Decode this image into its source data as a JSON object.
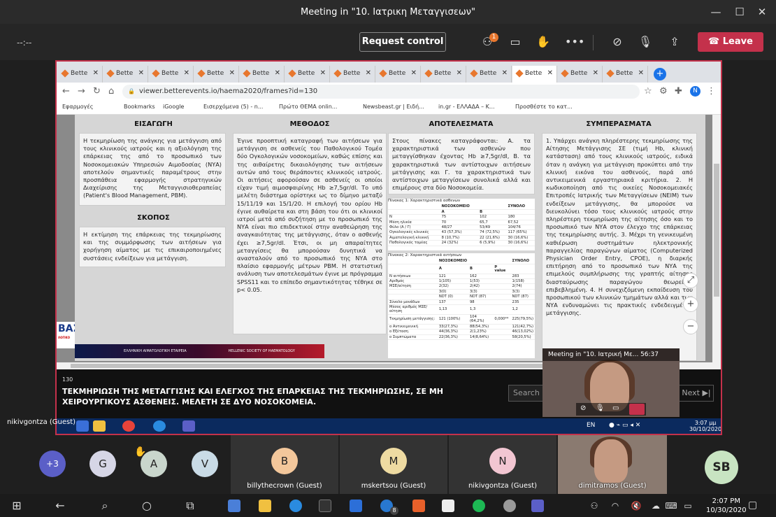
{
  "window": {
    "title": "Meeting in \"10. Ιατρικη Μεταγγισεων\""
  },
  "controls": {
    "timer": "--:--",
    "request_control": "Request control",
    "participants_badge": "1",
    "leave": "Leave"
  },
  "browser": {
    "tab_label": "Bette",
    "tab_count": 13,
    "url": "viewer.betterevents.io/haema2020/frames?id=130",
    "profile": "N",
    "bookmarks": [
      "Εφαρμογές",
      "Bookmarks",
      "iGoogle",
      "Εισερχόμενα (5) - n...",
      "Πρώτο ΘΕΜΑ onlin...",
      "Newsbeast.gr | Ειδή...",
      "in.gr - ΕΛΛΑΔΑ – Κ...",
      "Προσθέστε το κατ..."
    ]
  },
  "poster": {
    "h_intro": "ΕΙΣΑΓΩΓΗ",
    "intro": "Η τεκμηρίωση της ανάγκης για μετάγγιση από τους κλινικούς ιατρούς και η αξιολόγηση της επάρκειας της από το προσωπικό των Νοσοκομειακών Υπηρεσιών Αιμοδοσίας (ΝΥΑ) αποτελούν σημαντικές παραμέτρους στην προσπάθεια εφαρμογής στρατηγικών Διαχείρισης της Μεταγγισιοθεραπείας (Patient's Blood Management, PBM).",
    "h_aim": "ΣΚΟΠΟΣ",
    "aim": "Η εκτίμηση της επάρκειας της τεκμηρίωσης και της συμμόρφωσης των αιτήσεων για χορήγηση αίματος με τις επικαιροποιημένες συστάσεις ενδείξεων για μετάγγιση.",
    "h_method": "ΜΕΘΟΔΟΣ",
    "method": "Έγινε προοπτική καταγραφή των αιτήσεων για μετάγγιση σε ασθενείς του Παθολογικού Τομέα δύο Ογκολογικών νοσοκομείων, καθώς επίσης και της αιθαίρετης δικαιολόγησης των αιτήσεων αυτών από τους θεράποντες κλινικούς ιατρούς. Οι αιτήσεις αφορούσαν σε ασθενείς οι οποίοι είχαν τιμή αιμοσφαιρίνης Hb ≥7,5gr/dl. Το υπό μελέτη διάστημα ορίστηκε ως το δίμηνο μεταξύ 15/11/19 και 15/1/20. Η επιλογή του ορίου Hb έγινε αυθαίρετα και στη βάση του ότι οι κλινικοί ιατροί μετά από συζήτηση με το προσωπικό της ΝΥΑ είναι πιο επιδεκτικοί στην αναθεώρηση της αναγκαιότητας της μετάγγισης, όταν ο ασθενής έχει ≥7,5gr/dl. Έτσι, οι μη απαραίτητες μεταγγίσεις θα μπορούσαν δυνητικά να ανασταλούν από το προσωπικό της ΝΥΑ στο πλαίσιο εφαρμογής μέτρων PBM. Η στατιστική ανάλυση των αποτελεσμάτων έγινε με πρόγραμμα SPSS11 και το επίπεδο σημαντικότητας τέθηκε σε p< 0.05.",
    "h_results": "ΑΠΟΤΕΛΕΣΜΑΤΑ",
    "results": "Στους πίνακες καταγράφονται: Α. τα χαρακτηριστικά των ασθενών που μεταγγίσθηκαν έχοντας Hb ≥7,5gr/dl, Β. τα χαρακτηριστικά των αντίστοιχων αιτήσεων μετάγγισης και Γ. τα χαρακτηριστικά των αντίστοιχων μεταγγίσεων συνολικά αλλά και επιμέρους στα δύο Νοσοκομεία.",
    "table1": {
      "caption": "Πίνακας 1: Χαρακτηριστικά ασθενών",
      "header": [
        "",
        "ΝΟΣΟΚΟΜΕΙΟ",
        "",
        "ΣΥΝΟΛΟ"
      ],
      "sub": [
        "",
        "A",
        "B",
        ""
      ],
      "rows": [
        [
          "N",
          "75",
          "102",
          "180"
        ],
        [
          "Μέση ηλικία",
          "70",
          "65,7",
          "67,52"
        ],
        [
          "Φύλο (Α / Γ)",
          "48/27",
          "53/49",
          "104/76"
        ],
        [
          "Ογκολογικές κλινικές",
          "43 (57,3%)",
          "74 (72,5%)",
          "117 (65%)"
        ],
        [
          "Αιματολογική κλινική",
          "8 (10,7%)",
          "22 (21,6%)",
          "30 (16,6%)"
        ],
        [
          "Παθολογικός τομέας",
          "24 (32%)",
          "6 (5,9%)",
          "30 (16,6%)"
        ]
      ]
    },
    "table2": {
      "caption": "Πίνακας 2: Χαρακτηριστικά αιτήσεων",
      "header": [
        "",
        "ΝΟΣΟΚΟΜΕΙΟ",
        "",
        "",
        "ΣΥΝΟΛΟ"
      ],
      "sub": [
        "",
        "A",
        "B",
        "p value",
        ""
      ],
      "rows": [
        [
          "N αιτήσεων",
          "121",
          "162",
          "",
          "283"
        ],
        [
          "Αριθμός",
          "1(105)",
          "1(53)",
          "",
          "1(158)"
        ],
        [
          "ΜΣΕ/αίτηση",
          "2(32)",
          "2(42)",
          "",
          "2(74)"
        ],
        [
          "",
          "3(0)",
          "3(3)",
          "",
          "3(3)"
        ],
        [
          "",
          "NDT (0)",
          "NDT (87)",
          "",
          "NDT (87)"
        ],
        [
          "Σύνολο μονάδων",
          "137",
          "98",
          "",
          "235"
        ],
        [
          "Μέσος αριθμός ΜΣΕ/αίτηση",
          "1,13",
          "1,3",
          "",
          "1,2"
        ],
        [
          "Τεκμηρίωση μετάγγισης:",
          "121 (100%)",
          "104 (64,2%)",
          "0,000**",
          "225(79,5%)"
        ],
        [
          "o Αντικειμενική",
          "33(27,3%)",
          "88(54,3%)",
          "",
          "121(42,7%)"
        ],
        [
          "o Εξέταση",
          "44(36,3%)",
          "2(1,23%)",
          "",
          "46(13,02%)"
        ],
        [
          "o Συμπτώματα",
          "22(36,3%)",
          "14(8,64%)",
          "",
          "58(20,5%)"
        ]
      ]
    },
    "h_concl": "ΣΥΜΠΕΡΑΣΜΑΤΑ",
    "concl": "1. Υπάρχει ανάγκη πληρέστερης τεκμηρίωσης της Αίτησης Μετάγγισης ΣΕ (τιμή Hb, κλινική κατάσταση) από τους κλινικούς ιατρούς, ειδικά όταν η ανάγκη για μετάγγιση προκύπτει από την κλινική εικόνα του ασθενούς, παρά από αντικειμενικά εργαστηριακά κριτήρια. 2. Η κωδικοποίηση από τις οικείες Νοσοκομειακές Επιτροπές Ιατρικής των Μεταγγίσεων (ΝΕΙΜ) των ενδείξεων μετάγγισης, θα μπορούσε να διευκολύνει τόσο τους κλινικούς ιατρούς στην πληρέστερη τεκμηρίωση της αίτησης όσο και το προσωπικό των ΝΥΑ στον έλεγχο της επάρκειας της τεκμηρίωσης αυτής. 3. Μέχρι τη γενικευμένη καθιέρωση συστημάτων ηλεκτρονικής παραγγελίας παραγώγων αίματος (Computerized Physician Order Entry, CPOE), η διαρκής επιτήρηση από το προσωπικό των ΝΥΑ της επιμελούς συμπλήρωσης της γραπτής αίτησης διασταύρωσης παραγώγου θεωρείται επιβεβλημένη. 4. Η συνεχιζόμενη εκπαίδευση του προσωπικού των κλινικών τμημάτων αλλά και των ΝΥΑ ενδυναμώνει τις πρακτικές ενδεδειγμένης μετάγγισης.",
    "logo": "ΒΑΣ",
    "logo_sub": "ΛΟΓΙΚΟ",
    "banner_left": "ΕΛΛΗΝΙΚΗ ΑΙΜΑΤΟΛΟΓΙΚΗ ΕΤΑΙΡΕΙΑ",
    "banner_right": "HELLENIC SOCIETY OF HAEMATOLOGY"
  },
  "viewer": {
    "frame_no": "130",
    "caption": "ΤΕΚΜΗΡΙΩΣΗ ΤΗΣ ΜΕΤΑΓΓΙΣΗΣ ΚΑΙ ΕΛΕΓΧΟΣ ΤΗΣ ΕΠΑΡΚΕΙΑΣ ΤΗΣ ΤΕΚΜΗΡΙΩΣΗΣ, ΣΕ ΜΗ ΧΕΙΡΟΥΡΓΙΚΟΥΣ ΑΣΘΕΝΕΙΣ. ΜΕΛΕΤΗ ΣΕ ΔΥΟ ΝΟΣΟΚΟΜΕΙΑ.",
    "search": "Search p",
    "next": "Next ▶|"
  },
  "remote_taskbar": {
    "user": "nikivgontza (Guest)",
    "lang": "EN",
    "time": "3:07 μμ",
    "date": "30/10/2020"
  },
  "pip": {
    "title": "Meeting in \"10. Ιατρική Με...",
    "time": "56:37"
  },
  "participants": {
    "more": "+3",
    "avatars": [
      {
        "initial": "G",
        "color": "#d6d6e6"
      },
      {
        "initial": "A",
        "color": "#c9d6cc"
      },
      {
        "initial": "V",
        "color": "#c9dbe6"
      }
    ],
    "tiles": [
      {
        "initial": "B",
        "name": "billythecrown (Guest)",
        "color": "#f3c79b"
      },
      {
        "initial": "M",
        "name": "mskertsou (Guest)",
        "color": "#eedba2"
      },
      {
        "initial": "N",
        "name": "nikivgontza (Guest)",
        "color": "#f2c6d2"
      }
    ],
    "video_name": "dimitramos (Guest)",
    "sb": "SB"
  },
  "taskbar": {
    "time": "2:07 PM",
    "date": "10/30/2020",
    "mail_badge": "8"
  }
}
